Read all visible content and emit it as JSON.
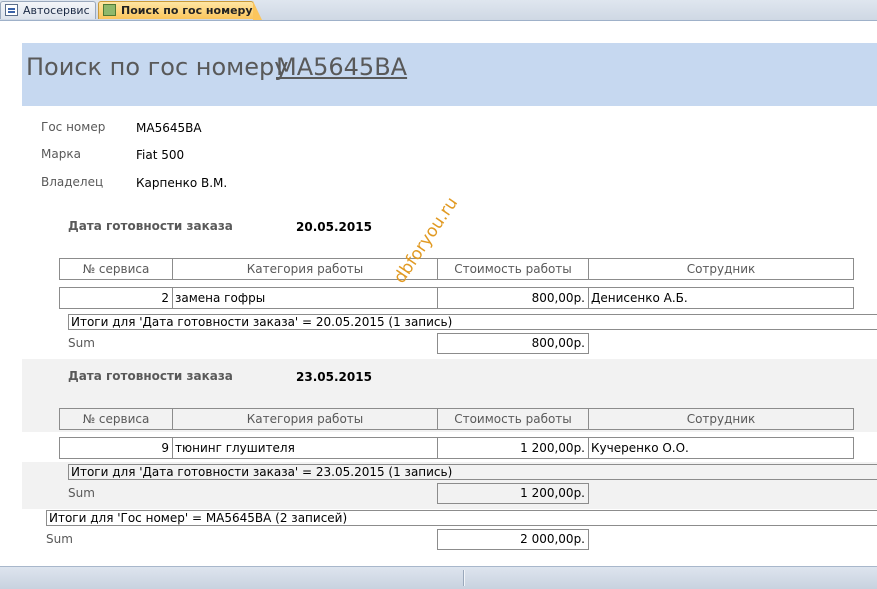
{
  "tabs": [
    {
      "label": "Автосервис",
      "icon": "table-form-icon",
      "active": false
    },
    {
      "label": "Поиск по гос номеру",
      "icon": "report-icon",
      "active": true
    }
  ],
  "header": {
    "title": "Поиск по гос номеру",
    "number": "MA5645BA",
    "band_color": "#c6d8f0"
  },
  "vehicle": {
    "plate_label": "Гос номер",
    "plate_value": "MA5645BA",
    "brand_label": "Марка",
    "brand_value": "Fiat 500",
    "owner_label": "Владелец",
    "owner_value": "Карпенко В.М."
  },
  "columns": [
    "№ сервиса",
    "Категория работы",
    "Стоимость работы",
    "Сотрудник"
  ],
  "groups": [
    {
      "date_label": "Дата готовности заказа",
      "date_value": "20.05.2015",
      "row": {
        "service_no": "2",
        "category": "замена гофры",
        "cost": "800,00р.",
        "employee": "Денисенко А.Б."
      },
      "total_text": "Итоги для 'Дата готовности заказа' =  20.05.2015 (1 запись)",
      "sum_label": "Sum",
      "sum_value": "800,00р."
    },
    {
      "date_label": "Дата готовности заказа",
      "date_value": "23.05.2015",
      "row": {
        "service_no": "9",
        "category": "тюнинг глушителя",
        "cost": "1 200,00р.",
        "employee": "Кучеренко О.О."
      },
      "total_text": "Итоги для 'Дата готовности заказа' =  23.05.2015 (1 запись)",
      "sum_label": "Sum",
      "sum_value": "1 200,00р."
    }
  ],
  "grand_total": {
    "text": "Итоги для 'Гос номер' =  MA5645BA (2 записей)",
    "sum_label": "Sum",
    "sum_value": "2 000,00р."
  },
  "watermark": "dbforyou.ru"
}
